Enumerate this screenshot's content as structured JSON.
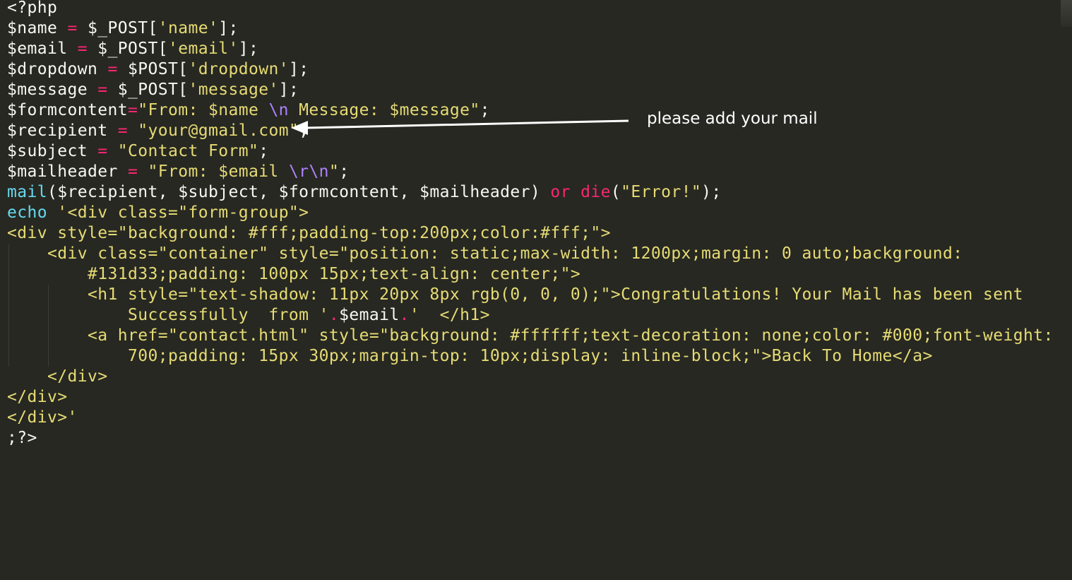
{
  "editor": {
    "colors": {
      "background": "#272822",
      "plain": "#f8f8f2",
      "operator": "#f92672",
      "string": "#e6db74",
      "escape": "#ae81ff",
      "function": "#66d9ef"
    },
    "lines": [
      [
        {
          "t": "<?php",
          "c": "plain"
        }
      ],
      [
        {
          "t": "$name ",
          "c": "plain"
        },
        {
          "t": "=",
          "c": "op"
        },
        {
          "t": " $_POST[",
          "c": "plain"
        },
        {
          "t": "'name'",
          "c": "str"
        },
        {
          "t": "];",
          "c": "plain"
        }
      ],
      [
        {
          "t": "$email ",
          "c": "plain"
        },
        {
          "t": "=",
          "c": "op"
        },
        {
          "t": " $_POST[",
          "c": "plain"
        },
        {
          "t": "'email'",
          "c": "str"
        },
        {
          "t": "];",
          "c": "plain"
        }
      ],
      [
        {
          "t": "$dropdown ",
          "c": "plain"
        },
        {
          "t": "=",
          "c": "op"
        },
        {
          "t": " $POST[",
          "c": "plain"
        },
        {
          "t": "'dropdown'",
          "c": "str"
        },
        {
          "t": "];",
          "c": "plain"
        }
      ],
      [
        {
          "t": "$message ",
          "c": "plain"
        },
        {
          "t": "=",
          "c": "op"
        },
        {
          "t": " $_POST[",
          "c": "plain"
        },
        {
          "t": "'message'",
          "c": "str"
        },
        {
          "t": "];",
          "c": "plain"
        }
      ],
      [
        {
          "t": "$formcontent",
          "c": "plain"
        },
        {
          "t": "=",
          "c": "op"
        },
        {
          "t": "\"From: $name ",
          "c": "str"
        },
        {
          "t": "\\n",
          "c": "esc"
        },
        {
          "t": " Message: $message\"",
          "c": "str"
        },
        {
          "t": ";",
          "c": "plain"
        }
      ],
      [
        {
          "t": "$recipient ",
          "c": "plain"
        },
        {
          "t": "=",
          "c": "op"
        },
        {
          "t": " ",
          "c": "plain"
        },
        {
          "t": "\"your@gmail.com\"",
          "c": "str"
        },
        {
          "t": ";",
          "c": "plain"
        }
      ],
      [
        {
          "t": "$subject ",
          "c": "plain"
        },
        {
          "t": "=",
          "c": "op"
        },
        {
          "t": " ",
          "c": "plain"
        },
        {
          "t": "\"Contact Form\"",
          "c": "str"
        },
        {
          "t": ";",
          "c": "plain"
        }
      ],
      [
        {
          "t": "$mailheader ",
          "c": "plain"
        },
        {
          "t": "=",
          "c": "op"
        },
        {
          "t": " ",
          "c": "plain"
        },
        {
          "t": "\"From: $email ",
          "c": "str"
        },
        {
          "t": "\\r\\n",
          "c": "esc"
        },
        {
          "t": "\"",
          "c": "str"
        },
        {
          "t": ";",
          "c": "plain"
        }
      ],
      [
        {
          "t": "mail",
          "c": "fn"
        },
        {
          "t": "($recipient, $subject, $formcontent, $mailheader) ",
          "c": "plain"
        },
        {
          "t": "or",
          "c": "op"
        },
        {
          "t": " ",
          "c": "plain"
        },
        {
          "t": "die",
          "c": "op"
        },
        {
          "t": "(",
          "c": "plain"
        },
        {
          "t": "\"Error!\"",
          "c": "str"
        },
        {
          "t": ");",
          "c": "plain"
        }
      ],
      [
        {
          "t": "echo",
          "c": "fn"
        },
        {
          "t": " ",
          "c": "plain"
        },
        {
          "t": "'<div class=\"form-group\">",
          "c": "str"
        }
      ],
      [
        {
          "t": "<div style=\"background: #fff;padding-top:200px;color:#fff;\">",
          "c": "str"
        }
      ],
      [
        {
          "t": "    <div class=\"container\" style=\"position: static;max-width: 1200px;margin: 0 auto;background:",
          "c": "str"
        }
      ],
      [
        {
          "t": "        #131d33;padding: 100px 15px;text-align: center;\">",
          "c": "str"
        }
      ],
      [
        {
          "t": "        <h1 style=\"text-shadow: 11px 20px 8px rgb(0, 0, 0);\">Congratulations! Your Mail has been sent",
          "c": "str"
        }
      ],
      [
        {
          "t": "            Successfully  from ",
          "c": "str"
        },
        {
          "t": "'",
          "c": "str"
        },
        {
          "t": ".",
          "c": "op"
        },
        {
          "t": "$email",
          "c": "plain"
        },
        {
          "t": ".",
          "c": "op"
        },
        {
          "t": "'  </h1>",
          "c": "str"
        }
      ],
      [
        {
          "t": "        <a href=\"contact.html\" style=\"background: #ffffff;text-decoration: none;color: #000;font-weight:",
          "c": "str"
        }
      ],
      [
        {
          "t": "            700;padding: 15px 30px;margin-top: 10px;display: inline-block;\">Back To Home</a>",
          "c": "str"
        }
      ],
      [
        {
          "t": "    </div>",
          "c": "str"
        }
      ],
      [
        {
          "t": "</div>",
          "c": "str"
        }
      ],
      [
        {
          "t": "</div>'",
          "c": "str"
        }
      ],
      [
        {
          "t": ";?>",
          "c": "plain"
        }
      ]
    ]
  },
  "annotation": {
    "text": "please add your mail",
    "color": "#ffffff"
  }
}
